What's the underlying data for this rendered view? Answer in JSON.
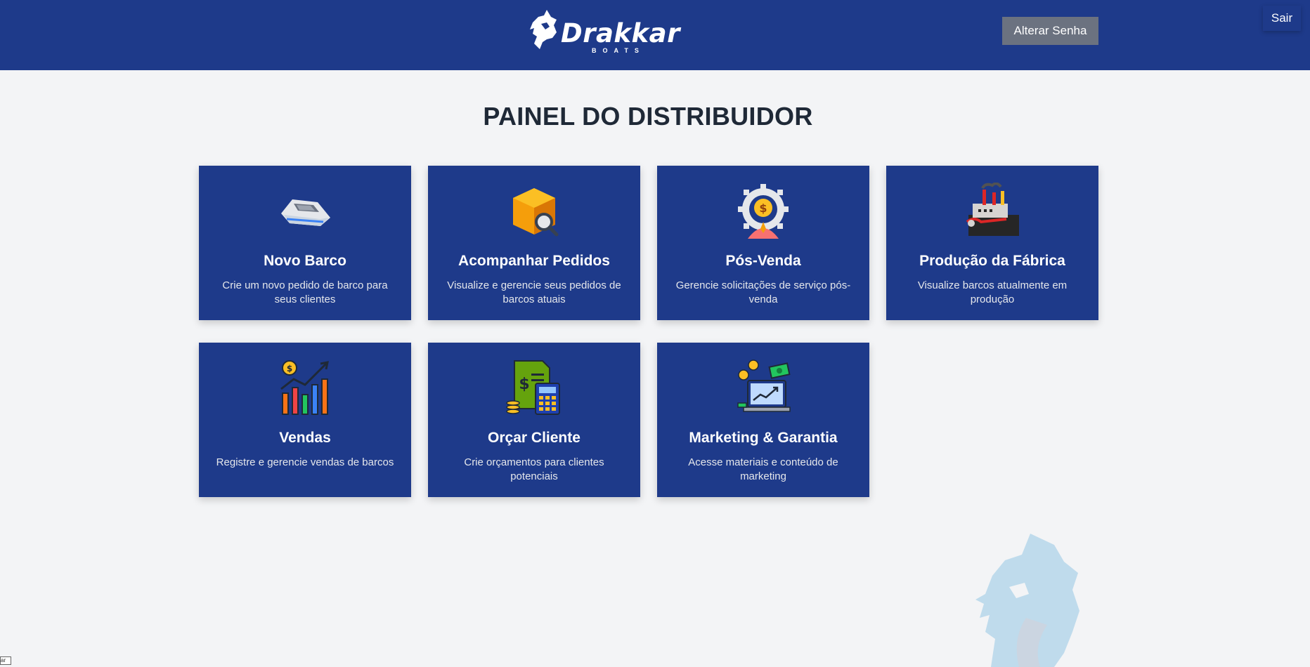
{
  "header": {
    "brand": "Drakkar",
    "brand_sub": "BOATS",
    "change_password_label": "Alterar Senha",
    "logout_label": "Sair"
  },
  "page": {
    "title": "PAINEL DO DISTRIBUIDOR"
  },
  "cards": [
    {
      "title": "Novo Barco",
      "description": "Crie um novo pedido de barco para seus clientes",
      "icon": "boat-icon"
    },
    {
      "title": "Acompanhar Pedidos",
      "description": "Visualize e gerencie seus pedidos de barcos atuais",
      "icon": "package-search-icon"
    },
    {
      "title": "Pós-Venda",
      "description": "Gerencie solicitações de serviço pós-venda",
      "icon": "service-gear-icon"
    },
    {
      "title": "Produção da Fábrica",
      "description": "Visualize barcos atualmente em produção",
      "icon": "factory-icon"
    },
    {
      "title": "Vendas",
      "description": "Registre e gerencie vendas de barcos",
      "icon": "sales-chart-icon"
    },
    {
      "title": "Orçar Cliente",
      "description": "Crie orçamentos para clientes potenciais",
      "icon": "quote-calculator-icon"
    },
    {
      "title": "Marketing & Garantia",
      "description": "Acesse materiais e conteúdo de marketing",
      "icon": "marketing-laptop-icon"
    }
  ],
  "corner_tooltip": "ar",
  "colors": {
    "header_bg": "#1e3a8a",
    "card_bg": "#1e3a8a",
    "page_bg": "#f3f4f6",
    "button_gray": "#6b7280"
  }
}
